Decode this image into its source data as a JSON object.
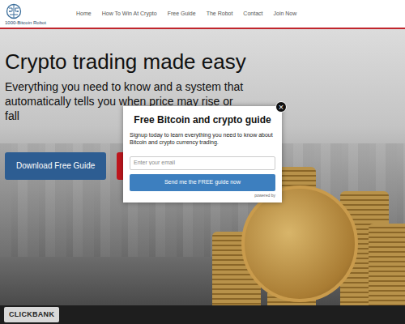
{
  "header": {
    "logo": "1000-Bitcoin Robot"
  },
  "nav": [
    {
      "label": "Home"
    },
    {
      "label": "How To Win At Crypto"
    },
    {
      "label": "Free Guide"
    },
    {
      "label": "The Robot"
    },
    {
      "label": "Contact"
    },
    {
      "label": "Join Now"
    }
  ],
  "hero": {
    "title": "Crypto trading made easy",
    "subtitle": "Everything you need to know and a system that automatically tells you when price may rise or fall",
    "buttons": [
      "Download Free Guide"
    ]
  },
  "modal": {
    "close": "×",
    "title": "Free Bitcoin and crypto guide",
    "text": "Signup today to learn everything you need to know about Bitcoin and crypto currency trading.",
    "email_placeholder": "Enter your email",
    "submit": "Send me the FREE guide now",
    "powered_by": "powered by"
  },
  "footer": {
    "badge": "CLICKBANK"
  }
}
